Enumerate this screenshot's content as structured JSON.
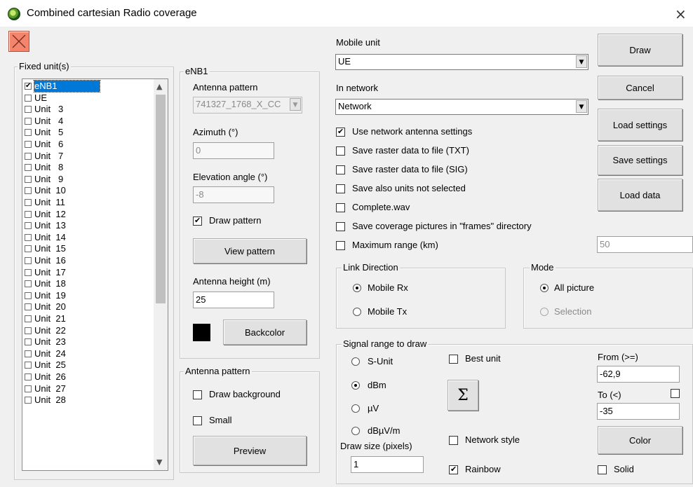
{
  "window": {
    "title": "Combined cartesian Radio coverage",
    "close_glyph": "×"
  },
  "fixed_units": {
    "group_label": "Fixed unit(s)",
    "items": [
      {
        "label": "eNB1",
        "checked": true,
        "selected": true
      },
      {
        "label": "UE",
        "checked": false
      },
      {
        "label": "Unit   3",
        "checked": false
      },
      {
        "label": "Unit   4",
        "checked": false
      },
      {
        "label": "Unit   5",
        "checked": false
      },
      {
        "label": "Unit   6",
        "checked": false
      },
      {
        "label": "Unit   7",
        "checked": false
      },
      {
        "label": "Unit   8",
        "checked": false
      },
      {
        "label": "Unit   9",
        "checked": false
      },
      {
        "label": "Unit  10",
        "checked": false
      },
      {
        "label": "Unit  11",
        "checked": false
      },
      {
        "label": "Unit  12",
        "checked": false
      },
      {
        "label": "Unit  13",
        "checked": false
      },
      {
        "label": "Unit  14",
        "checked": false
      },
      {
        "label": "Unit  15",
        "checked": false
      },
      {
        "label": "Unit  16",
        "checked": false
      },
      {
        "label": "Unit  17",
        "checked": false
      },
      {
        "label": "Unit  18",
        "checked": false
      },
      {
        "label": "Unit  19",
        "checked": false
      },
      {
        "label": "Unit  20",
        "checked": false
      },
      {
        "label": "Unit  21",
        "checked": false
      },
      {
        "label": "Unit  22",
        "checked": false
      },
      {
        "label": "Unit  23",
        "checked": false
      },
      {
        "label": "Unit  24",
        "checked": false
      },
      {
        "label": "Unit  25",
        "checked": false
      },
      {
        "label": "Unit  26",
        "checked": false
      },
      {
        "label": "Unit  27",
        "checked": false
      },
      {
        "label": "Unit  28",
        "checked": false
      }
    ]
  },
  "enb": {
    "group_label": "eNB1",
    "antenna_pattern_label": "Antenna pattern",
    "antenna_pattern_value": "741327_1768_X_CC",
    "azimuth_label": "Azimuth (°)",
    "azimuth_value": "0",
    "elevation_label": "Elevation angle (°)",
    "elevation_value": "-8",
    "draw_pattern_label": "Draw pattern",
    "draw_pattern_checked": true,
    "view_pattern_button": "View pattern",
    "antenna_height_label": "Antenna height (m)",
    "antenna_height_value": "25",
    "backcolor_button": "Backcolor",
    "backcolor": "#000000"
  },
  "antenna_pattern_group": {
    "group_label": "Antenna pattern",
    "draw_background_label": "Draw background",
    "small_label": "Small",
    "preview_button": "Preview"
  },
  "mobile": {
    "mobile_unit_label": "Mobile unit",
    "mobile_unit_value": "UE",
    "in_network_label": "In network",
    "in_network_value": "Network"
  },
  "options": [
    {
      "label": "Use network antenna settings",
      "checked": true
    },
    {
      "label": "Save raster data to file (TXT)",
      "checked": false
    },
    {
      "label": "Save raster data to file (SIG)",
      "checked": false
    },
    {
      "label": "Save also units not selected",
      "checked": false
    },
    {
      "label": "Complete.wav",
      "checked": false
    },
    {
      "label": "Save coverage pictures in \"frames\" directory",
      "checked": false
    },
    {
      "label": "Maximum range (km)",
      "checked": false
    }
  ],
  "max_range_value": "50",
  "buttons": {
    "draw": "Draw",
    "cancel": "Cancel",
    "load_settings": "Load settings",
    "save_settings": "Save settings",
    "load_data": "Load data"
  },
  "link_direction": {
    "group_label": "Link Direction",
    "mobile_rx": "Mobile Rx",
    "mobile_tx": "Mobile Tx",
    "selected": "Mobile Rx"
  },
  "mode": {
    "group_label": "Mode",
    "all_picture": "All picture",
    "selection": "Selection",
    "selected": "All picture"
  },
  "signal_range": {
    "group_label": "Signal range to draw",
    "units": [
      "S-Unit",
      "dBm",
      "µV",
      "dBµV/m"
    ],
    "selected_unit": "dBm",
    "best_unit_label": "Best unit",
    "sigma_button": "Σ",
    "network_style_label": "Network style",
    "rainbow_label": "Rainbow",
    "rainbow_checked": true,
    "draw_size_label": "Draw size (pixels)",
    "draw_size_value": "1",
    "from_label": "From (>=)",
    "from_value": "-62,9",
    "to_label": "To (<)",
    "to_value": "-35",
    "color_button": "Color",
    "solid_label": "Solid"
  }
}
